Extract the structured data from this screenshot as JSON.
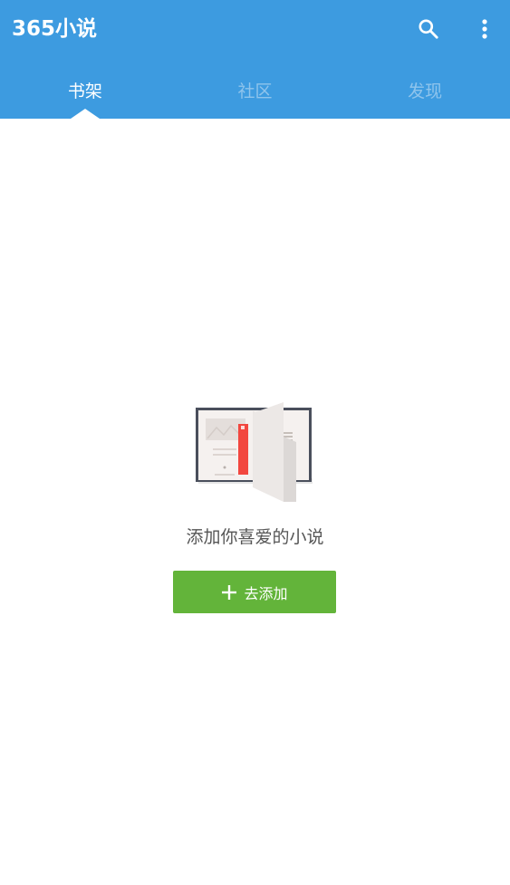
{
  "colors": {
    "primary": "#3d9be0",
    "tab_inactive": "#8fc4ec",
    "accent": "#63b43a",
    "bookmark": "#f2473f"
  },
  "appbar": {
    "title": "365小说",
    "actions": [
      {
        "name": "search",
        "icon": "search-icon"
      },
      {
        "name": "more",
        "icon": "more-vert-icon"
      }
    ]
  },
  "tabs": [
    {
      "label": "书架",
      "active": true
    },
    {
      "label": "社区",
      "active": false
    },
    {
      "label": "发现",
      "active": false
    }
  ],
  "empty_state": {
    "illustration": "open-book-icon",
    "message": "添加你喜爱的小说",
    "button_label": "去添加",
    "button_icon": "plus-icon"
  }
}
